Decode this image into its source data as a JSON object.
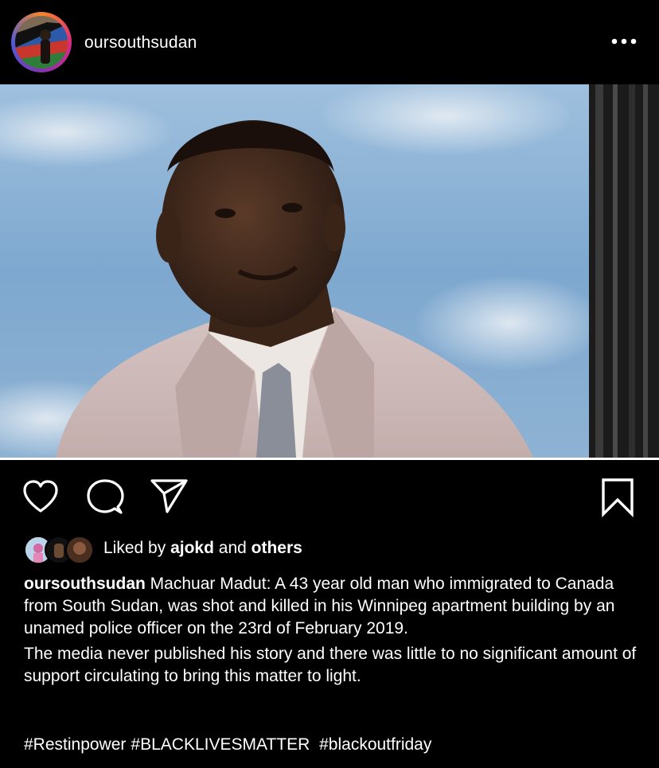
{
  "post": {
    "username": "oursouthsudan",
    "more_icon": "more-horizontal-icon"
  },
  "actions": {
    "like_icon": "heart-icon",
    "comment_icon": "comment-icon",
    "share_icon": "send-icon",
    "save_icon": "bookmark-icon"
  },
  "likes": {
    "prefix": "Liked by",
    "user": "ajokd",
    "conjunction": "and",
    "others": "others"
  },
  "caption": {
    "username": "oursouthsudan",
    "text1": "Machuar Madut: A 43 year old man who immigrated to Canada from South Sudan, was shot and killed in his Winnipeg apartment building by an unamed police officer on the 23rd of February 2019.",
    "text2": "The media never published his story and there was little to no significant amount of support circulating to bring this matter to light.",
    "hashtags": [
      "#Restinpower",
      "#BLACKLIVESMATTER",
      "#blackoutfriday"
    ]
  },
  "colors": {
    "background": "#000000",
    "text": "#ffffff",
    "ring_gradient": [
      "#f58529",
      "#dd2a7b",
      "#8134af",
      "#515bd4"
    ]
  }
}
